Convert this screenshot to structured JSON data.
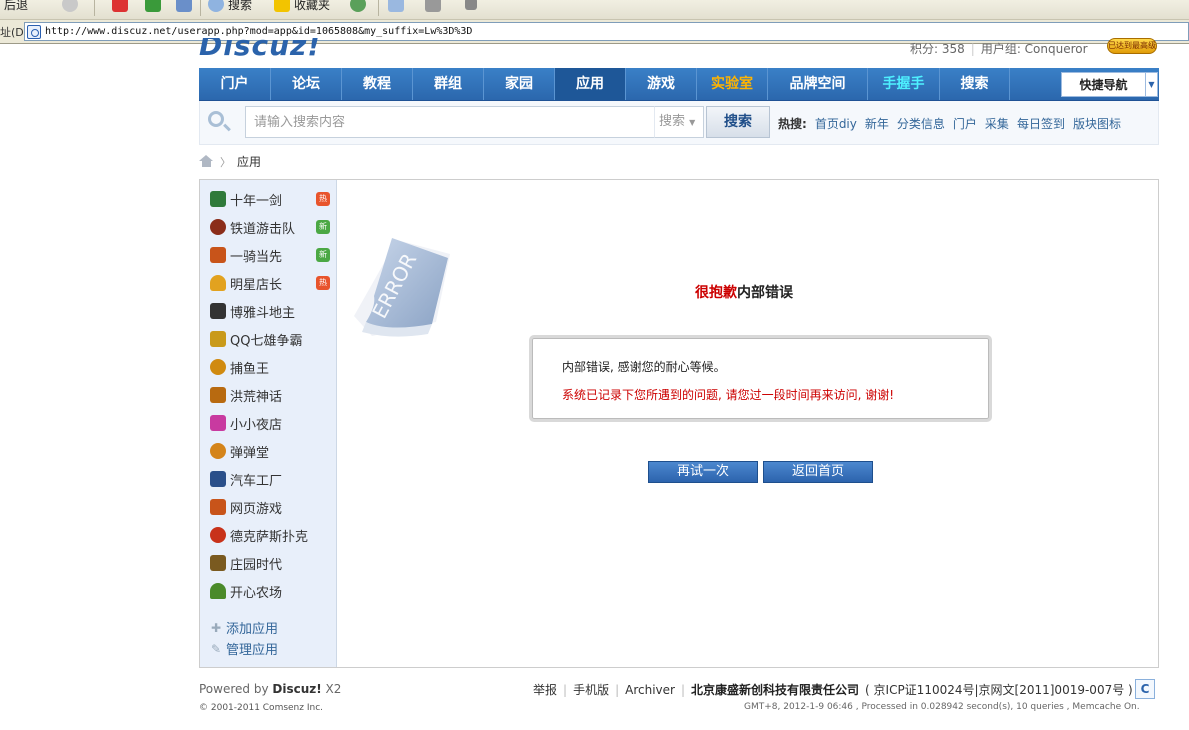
{
  "browser": {
    "toolbar": {
      "item1": "后退",
      "search_label": "搜索",
      "favorites_label": "收藏夹"
    },
    "address": {
      "label": "址(D)",
      "url": "http://www.discuz.net/userapp.php?mod=app&id=1065808&my_suffix=Lw%3D%3D"
    }
  },
  "header": {
    "logo_text": "Discuz!",
    "credits": "积分: 358",
    "usergroup": "用户组: Conqueror",
    "badge_text": "已达到最高级"
  },
  "nav": {
    "items": [
      "门户",
      "论坛",
      "教程",
      "群组",
      "家园",
      "应用",
      "游戏",
      "实验室",
      "品牌空间",
      "手握手",
      "搜索"
    ],
    "active": "应用",
    "quicknav_label": "快捷导航"
  },
  "search": {
    "placeholder": "请输入搜索内容",
    "type_label": "搜索",
    "button_label": "搜索",
    "hot_label": "热搜:",
    "hot_items": [
      "首页diy",
      "新年",
      "分类信息",
      "门户",
      "采集",
      "每日签到",
      "版块图标"
    ]
  },
  "breadcrumb": {
    "current": "应用"
  },
  "sidebar": {
    "apps": [
      {
        "name": "十年一剑",
        "badge": "热",
        "icon_color": "#2f7a3a",
        "icon": "plane-icon"
      },
      {
        "name": "铁道游击队",
        "badge": "新",
        "icon_color": "#8b2d1a",
        "icon": "train-icon"
      },
      {
        "name": "一骑当先",
        "badge": "新",
        "icon_color": "#c8541a",
        "icon": "horse-icon"
      },
      {
        "name": "明星店长",
        "badge": "热",
        "icon_color": "#e2a21f",
        "icon": "bag-icon"
      },
      {
        "name": "博雅斗地主",
        "badge": "",
        "icon_color": "#333333",
        "icon": "cards-icon"
      },
      {
        "name": "QQ七雄争霸",
        "badge": "",
        "icon_color": "#c99a1a",
        "icon": "sword-icon"
      },
      {
        "name": "捕鱼王",
        "badge": "",
        "icon_color": "#d08a10",
        "icon": "fish-icon"
      },
      {
        "name": "洪荒神话",
        "badge": "",
        "icon_color": "#b86a10",
        "icon": "myth-icon"
      },
      {
        "name": "小小夜店",
        "badge": "",
        "icon_color": "#c83aa0",
        "icon": "nightclub-icon"
      },
      {
        "name": "弹弹堂",
        "badge": "",
        "icon_color": "#d4841a",
        "icon": "ddt-icon"
      },
      {
        "name": "汽车工厂",
        "badge": "",
        "icon_color": "#2a4f8a",
        "icon": "car-icon"
      },
      {
        "name": "网页游戏",
        "badge": "",
        "icon_color": "#c8541a",
        "icon": "game-icon"
      },
      {
        "name": "德克萨斯扑克",
        "badge": "",
        "icon_color": "#c8321a",
        "icon": "poker-icon"
      },
      {
        "name": "庄园时代",
        "badge": "",
        "icon_color": "#7a5a20",
        "icon": "manor-icon"
      },
      {
        "name": "开心农场",
        "badge": "",
        "icon_color": "#4a8a2a",
        "icon": "sprout-icon"
      }
    ],
    "add_app": "添加应用",
    "manage_app": "管理应用"
  },
  "error": {
    "graphic_text": "ERROR",
    "title_red": "很抱歉",
    "title_rest": "内部错误",
    "message1": "内部错误, 感谢您的耐心等候。",
    "message2": "系统已记录下您所遇到的问题, 请您过一段时间再来访问, 谢谢!",
    "retry_button": "再试一次",
    "home_button": "返回首页"
  },
  "footer": {
    "powered_prefix": "Powered by ",
    "powered_brand": "Discuz!",
    "powered_version": " X2",
    "copyright": "© 2001-2011 Comsenz Inc.",
    "links": [
      "举报",
      "手机版",
      "Archiver"
    ],
    "company": "北京康盛新创科技有限责任公司",
    "icp": "( 京ICP证110024号|京网文[2011]0019-007号 )",
    "stat": "GMT+8, 2012-1-9 06:46 , Processed in 0.028942 second(s), 10 queries , Memcache On."
  }
}
